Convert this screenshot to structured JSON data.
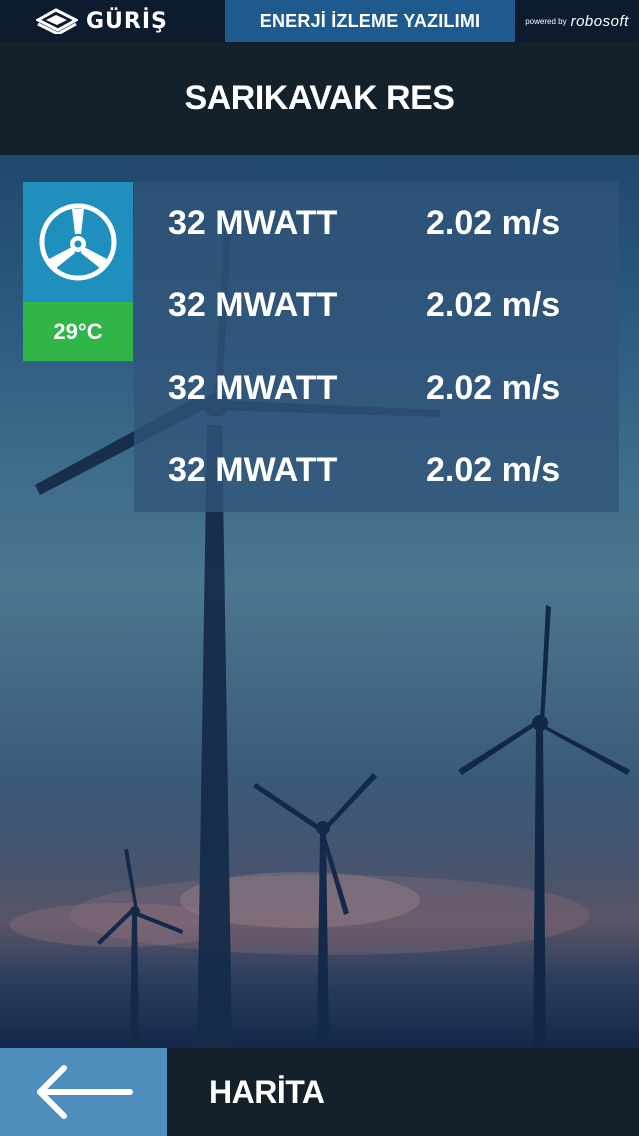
{
  "topbar": {
    "brand_name": "GÜRİŞ",
    "app_title": "ENERJİ İZLEME YAZILIMI",
    "powered_by": "powered by",
    "powered_logo": "robosoft"
  },
  "header": {
    "title": "SARIKAVAK RES"
  },
  "status": {
    "icon": "turbine-icon",
    "temperature": "29°C",
    "icon_bg": "#1f8fbd",
    "temp_bg": "#2fb548"
  },
  "readings": [
    {
      "power": "32 MWATT",
      "wind": "2.02 m/s"
    },
    {
      "power": "32 MWATT",
      "wind": "2.02 m/s"
    },
    {
      "power": "32 MWATT",
      "wind": "2.02 m/s"
    },
    {
      "power": "32 MWATT",
      "wind": "2.02 m/s"
    }
  ],
  "bottom": {
    "back_icon": "arrow-left-icon",
    "nav_label": "HARİTA"
  },
  "colors": {
    "topbar": "#0d1b2f",
    "app_title_bg": "#1e5a8e",
    "header_bg": "#14202a",
    "back_button_bg": "#4e8fbd"
  }
}
